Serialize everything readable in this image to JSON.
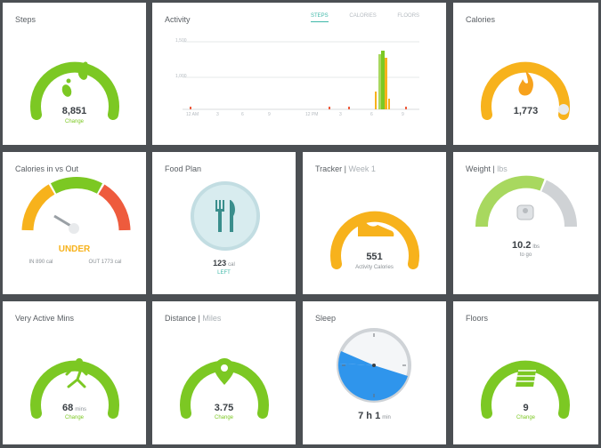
{
  "colors": {
    "green": "#7cc823",
    "lightgreen": "#a8d85f",
    "orange": "#f7b21c",
    "red": "#ee5b3d",
    "gray": "#d0d3d6",
    "teal": "#3a8e8c",
    "blue": "#2f95ec"
  },
  "steps": {
    "title": "Steps",
    "value": "8,851",
    "status": "Change",
    "icon": "footprints-icon",
    "progress": 0.88
  },
  "activity": {
    "title": "Activity",
    "tabs": [
      "STEPS",
      "CALORIES",
      "FLOORS"
    ],
    "y_labels": [
      "1,500",
      "1,000"
    ],
    "x_labels": [
      "12 AM",
      "3",
      "6",
      "9",
      "12 PM",
      "3",
      "6",
      "9"
    ]
  },
  "calories": {
    "title": "Calories",
    "value": "1,773",
    "icon": "flame-icon",
    "progress": 0.9
  },
  "cal_in_out": {
    "title": "Calories in vs Out",
    "status": "UNDER",
    "left": "IN 890 cal",
    "right": "OUT 1773 cal",
    "icon": "gauge-needle-icon"
  },
  "food_plan": {
    "title": "Food Plan",
    "value": "123",
    "unit": "cal",
    "status": "LEFT",
    "icon": "fork-knife-icon"
  },
  "tracker": {
    "title": "Tracker",
    "subtitle": "Week 1",
    "value": "551",
    "caption": "Activity Calories",
    "icon": "sneaker-icon",
    "progress": 0.85
  },
  "weight": {
    "title": "Weight",
    "subtitle": "lbs",
    "value": "10.2",
    "unit": "lbs",
    "caption": "to go",
    "icon": "scale-icon",
    "progress": 0.55
  },
  "very_active": {
    "title": "Very Active Mins",
    "value": "68",
    "unit": "mins",
    "status": "Change",
    "icon": "runner-icon",
    "progress": 1.0
  },
  "distance": {
    "title": "Distance",
    "subtitle": "Miles",
    "value": "3.75",
    "status": "Change",
    "icon": "map-pin-icon",
    "progress": 1.0
  },
  "sleep": {
    "title": "Sleep",
    "value": "7 h 1",
    "unit": "min",
    "icon": "clock-icon"
  },
  "floors": {
    "title": "Floors",
    "value": "9",
    "status": "Change",
    "icon": "stairs-icon",
    "progress": 1.0
  }
}
